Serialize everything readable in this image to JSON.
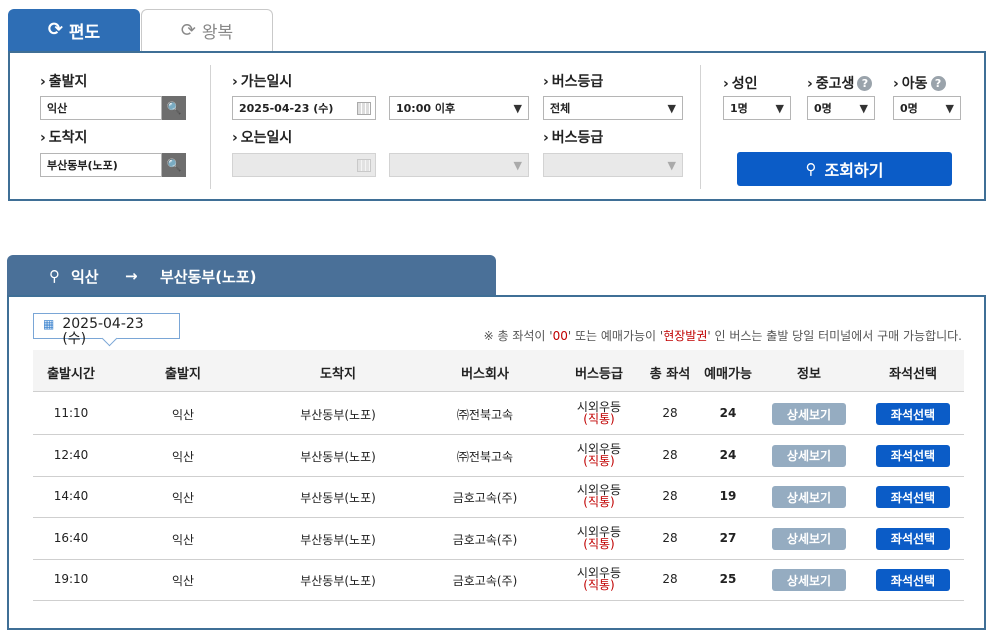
{
  "tabs": {
    "oneway_label": "편도",
    "roundtrip_label": "왕복"
  },
  "search": {
    "departure_label": "출발지",
    "departure_value": "익산",
    "arrival_label": "도착지",
    "arrival_value": "부산동부(노포)",
    "go_date_label": "가는일시",
    "go_date_value": "2025-04-23 (수)",
    "go_time_value": "10:00 이후",
    "return_date_label": "오는일시",
    "grade_label_1": "버스등급",
    "grade_value_1": "전체",
    "grade_label_2": "버스등급",
    "adult_label": "성인",
    "adult_value": "1명",
    "student_label": "중고생",
    "student_value": "0명",
    "child_label": "아동",
    "child_value": "0명",
    "query_button": "조회하기"
  },
  "route": {
    "from": "익산",
    "arrow": "→",
    "to": "부산동부(노포)"
  },
  "results": {
    "date_chip": "2025-04-23 (수)",
    "notice_prefix": "※ 총 좌석이 '",
    "notice_zero": "00",
    "notice_mid": "' 또는 예매가능이 '",
    "notice_onsite": "현장발권",
    "notice_suffix": "' 인 버스는 출발 당일 터미널에서 구매 가능합니다.",
    "headers": {
      "time": "출발시간",
      "departure": "출발지",
      "arrival": "도착지",
      "company": "버스회사",
      "grade": "버스등급",
      "total_seats": "총 좌석",
      "available": "예매가능",
      "info": "정보",
      "seat_select": "좌석선택"
    },
    "rows": [
      {
        "time": "11:10",
        "departure": "익산",
        "arrival": "부산동부(노포)",
        "company": "㈜전북고속",
        "grade": "시외우등",
        "grade_sub": "(직통)",
        "total": "28",
        "available": "24",
        "detail": "상세보기",
        "seat": "좌석선택"
      },
      {
        "time": "12:40",
        "departure": "익산",
        "arrival": "부산동부(노포)",
        "company": "㈜전북고속",
        "grade": "시외우등",
        "grade_sub": "(직통)",
        "total": "28",
        "available": "24",
        "detail": "상세보기",
        "seat": "좌석선택"
      },
      {
        "time": "14:40",
        "departure": "익산",
        "arrival": "부산동부(노포)",
        "company": "금호고속(주)",
        "grade": "시외우등",
        "grade_sub": "(직통)",
        "total": "28",
        "available": "19",
        "detail": "상세보기",
        "seat": "좌석선택"
      },
      {
        "time": "16:40",
        "departure": "익산",
        "arrival": "부산동부(노포)",
        "company": "금호고속(주)",
        "grade": "시외우등",
        "grade_sub": "(직통)",
        "total": "28",
        "available": "27",
        "detail": "상세보기",
        "seat": "좌석선택"
      },
      {
        "time": "19:10",
        "departure": "익산",
        "arrival": "부산동부(노포)",
        "company": "금호고속(주)",
        "grade": "시외우등",
        "grade_sub": "(직통)",
        "total": "28",
        "available": "25",
        "detail": "상세보기",
        "seat": "좌석선택"
      }
    ]
  }
}
